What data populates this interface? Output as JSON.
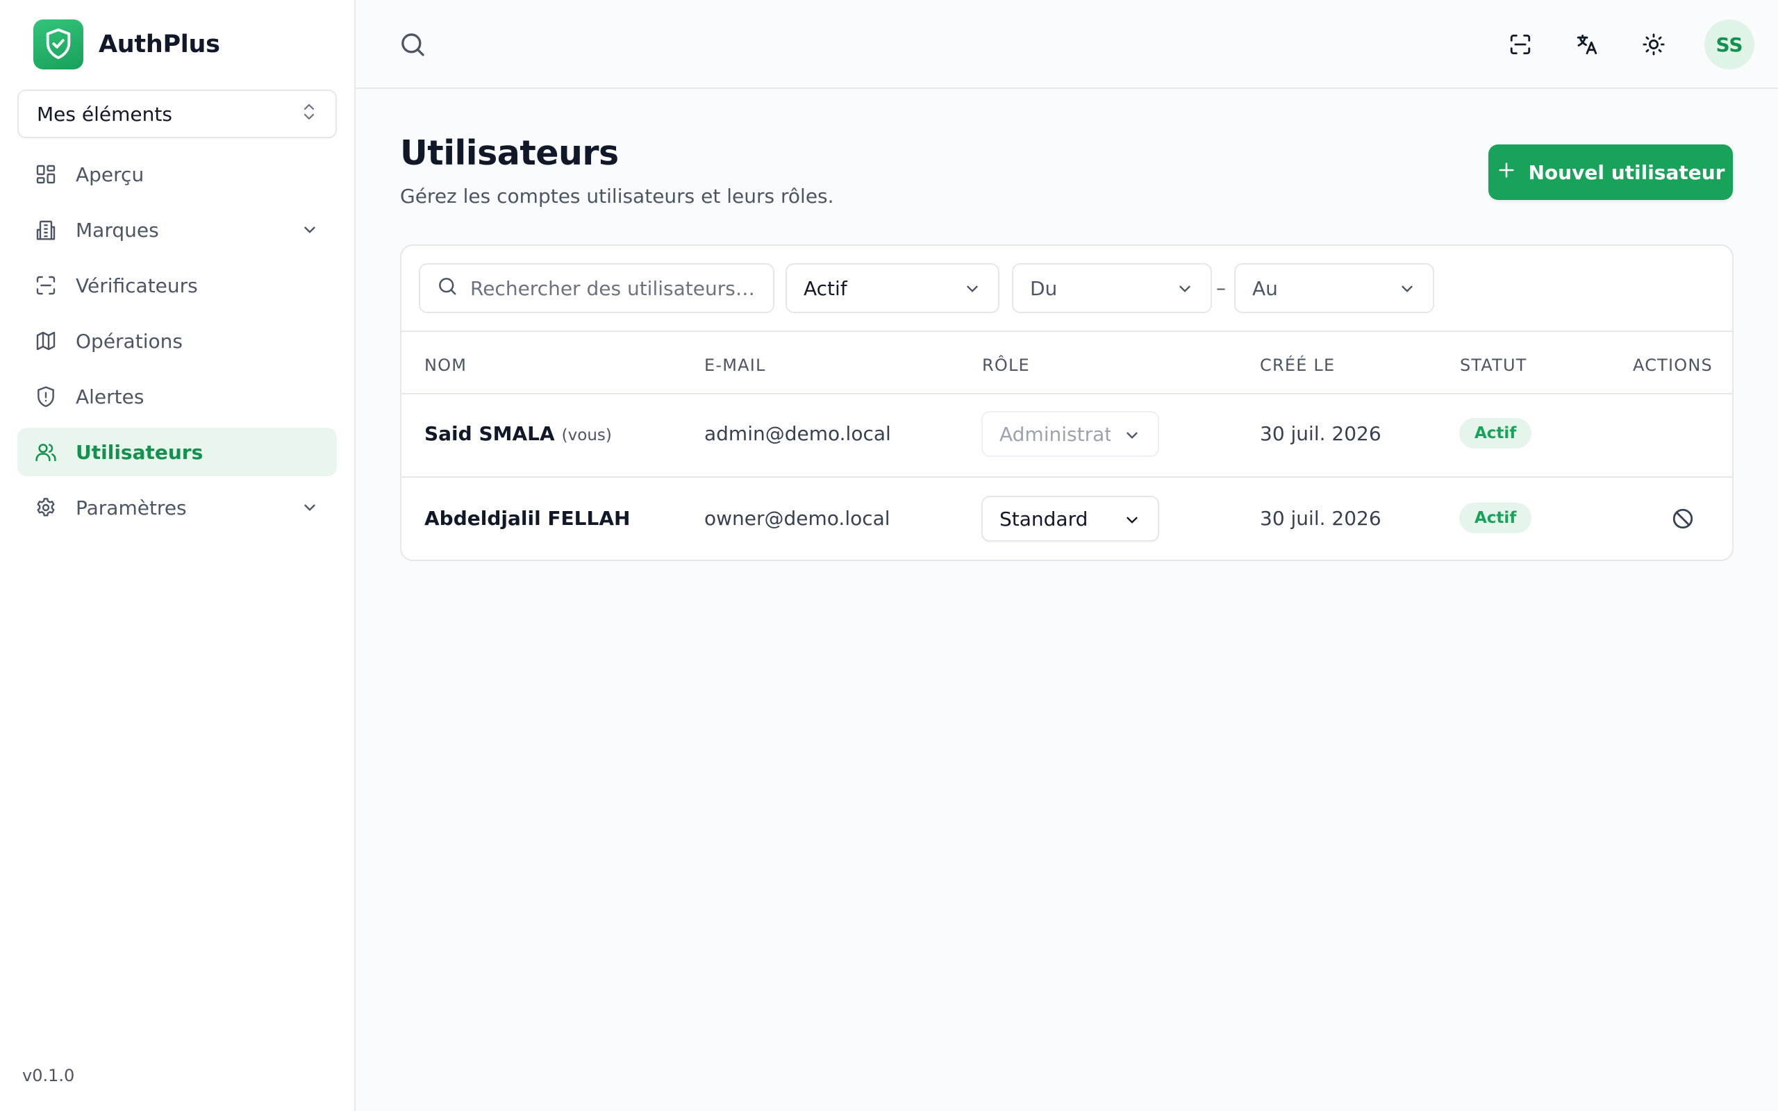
{
  "app": {
    "name": "AuthPlus",
    "version": "v0.1.0",
    "brand_color": "#19a35a"
  },
  "sidebar": {
    "workspace": "Mes éléments",
    "items": [
      {
        "label": "Aperçu",
        "icon": "grid-icon"
      },
      {
        "label": "Marques",
        "icon": "building-icon",
        "expandable": true
      },
      {
        "label": "Vérificateurs",
        "icon": "scan-icon"
      },
      {
        "label": "Opérations",
        "icon": "map-icon"
      },
      {
        "label": "Alertes",
        "icon": "shield-alert-icon"
      },
      {
        "label": "Utilisateurs",
        "icon": "users-icon",
        "active": true
      },
      {
        "label": "Paramètres",
        "icon": "gear-icon",
        "expandable": true
      }
    ]
  },
  "topbar": {
    "avatar_initials": "SS"
  },
  "page": {
    "title": "Utilisateurs",
    "subtitle": "Gérez les comptes utilisateurs et leurs rôles.",
    "new_button": "Nouvel utilisateur"
  },
  "filters": {
    "search_placeholder": "Rechercher des utilisateurs…",
    "status": "Actif",
    "from": "Du",
    "separator": "–",
    "to": "Au"
  },
  "table": {
    "headers": {
      "name": "NOM",
      "email": "E-MAIL",
      "role": "RÔLE",
      "created": "CRÉÉ LE",
      "status": "STATUT",
      "actions": "ACTIONS"
    },
    "rows": [
      {
        "name": "Said SMALA",
        "you": "(vous)",
        "email": "admin@demo.local",
        "role": "Administrateur",
        "created": "30 juil. 2026",
        "status": "Actif"
      },
      {
        "name": "Abdeldjalil FELLAH",
        "email": "owner@demo.local",
        "role": "Standard",
        "created": "30 juil. 2026",
        "status": "Actif"
      }
    ]
  }
}
